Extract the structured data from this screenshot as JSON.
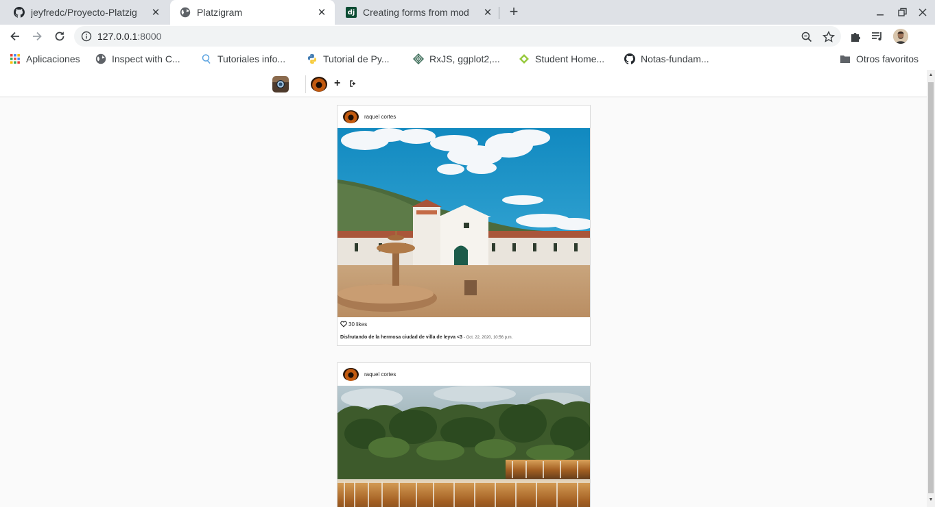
{
  "browser": {
    "tabs": [
      {
        "title": "jeyfredc/Proyecto-Platzig",
        "icon": "github-icon",
        "active": false
      },
      {
        "title": "Platzigram",
        "icon": "globe-icon",
        "active": true
      },
      {
        "title": "Creating forms from mod",
        "icon": "django-icon",
        "active": false
      }
    ],
    "new_tab_glyph": "+",
    "close_glyph": "✕",
    "url_host": "127.0.0.1",
    "url_port": ":8000"
  },
  "bookmarks": [
    {
      "label": "Aplicaciones",
      "icon": "apps-grid-icon"
    },
    {
      "label": "Inspect with C...",
      "icon": "globe-icon"
    },
    {
      "label": "Tutoriales info...",
      "icon": "search-bulb-icon"
    },
    {
      "label": "Tutorial de Py...",
      "icon": "python-icon"
    },
    {
      "label": "RxJS, ggplot2,...",
      "icon": "diamond-icon"
    },
    {
      "label": "Student Home...",
      "icon": "leaf-icon"
    },
    {
      "label": "Notas-fundam...",
      "icon": "github-icon"
    }
  ],
  "other_bookmarks": "Otros favoritos",
  "app": {
    "nav_plus": "+"
  },
  "posts": [
    {
      "username": "raquel cortes",
      "likes": "30 likes",
      "caption": "Disfrutando de la hermosa ciudad de villa de leyva <3",
      "date": "Oct. 22, 2020, 10:56 p.m."
    },
    {
      "username": "raquel cortes"
    }
  ]
}
